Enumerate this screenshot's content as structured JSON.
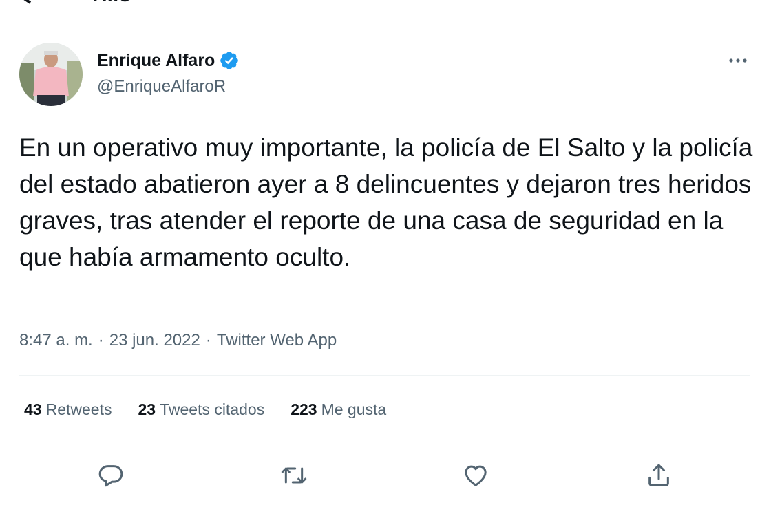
{
  "header": {
    "title": "Hilo"
  },
  "tweet": {
    "author_name": "Enrique Alfaro",
    "handle": "@EnriqueAlfaroR",
    "text": "En un operativo muy importante, la policía de El Salto y la policía del estado abatieron ayer a 8 delincuentes y dejaron tres heridos graves, tras atender el reporte de una casa de seguridad en la que había armamento oculto.",
    "time": "8:47 a. m.",
    "date": "23 jun. 2022",
    "source": "Twitter Web App",
    "separator": "·"
  },
  "stats": {
    "retweets_count": "43",
    "retweets_label": "Retweets",
    "quotes_count": "23",
    "quotes_label": "Tweets citados",
    "likes_count": "223",
    "likes_label": "Me gusta"
  },
  "colors": {
    "text": "#0f1419",
    "secondary": "#536471",
    "verified": "#1d9bf0",
    "divider": "#eff3f4"
  },
  "icons": [
    "back-arrow-icon",
    "verified-badge-icon",
    "more-icon",
    "reply-icon",
    "retweet-icon",
    "like-icon",
    "share-icon"
  ]
}
